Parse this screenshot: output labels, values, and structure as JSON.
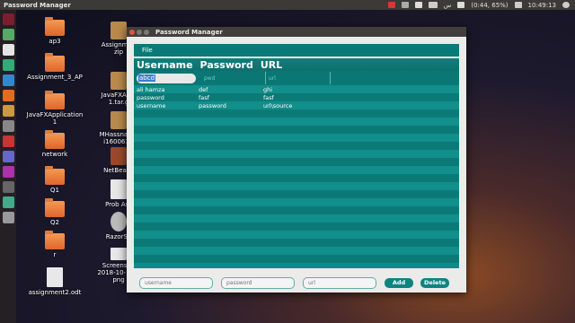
{
  "topbar": {
    "title": "Password Manager",
    "battery": "(0:44, 65%)",
    "time": "10:49:13",
    "day": "س"
  },
  "desktop": {
    "icons": [
      {
        "label": "ap3"
      },
      {
        "label": "Assignment_3_AP"
      },
      {
        "label": "JavaFXApplication\n1"
      },
      {
        "label": "network"
      },
      {
        "label": "Q1"
      },
      {
        "label": "Q2"
      },
      {
        "label": "r"
      },
      {
        "label": "assignment2.odt"
      },
      {
        "label": "Assignmen\nzip"
      },
      {
        "label": "JavaFXAppl\n1.tar.g"
      },
      {
        "label": "MHassnainB\ni160061.t"
      },
      {
        "label": "NetBeans"
      },
      {
        "label": "Prob Ass"
      },
      {
        "label": "RazorSo"
      },
      {
        "label": "Screensho\n2018-10-17 2\npng"
      }
    ]
  },
  "window": {
    "title": "Password Manager",
    "menu": {
      "file": "File"
    },
    "table": {
      "headers": [
        "Username",
        "Password",
        "URL"
      ],
      "edit_value": "abcd",
      "edit_placeholders": [
        "pwd",
        "url"
      ],
      "rows": [
        {
          "username": "ali hamza",
          "password": "def",
          "url": "ghi"
        },
        {
          "username": "password",
          "password": "fasf",
          "url": "fasf"
        },
        {
          "username": "username",
          "password": "password",
          "url": "url\\source"
        }
      ]
    },
    "form": {
      "username_placeholder": "username",
      "password_placeholder": "password",
      "url_placeholder": "url",
      "add_label": "Add",
      "delete_label": "Delete"
    }
  },
  "colors": {
    "teal": "#0e8c89",
    "teal_dark": "#0b7775",
    "panel": "#3b3a37"
  }
}
